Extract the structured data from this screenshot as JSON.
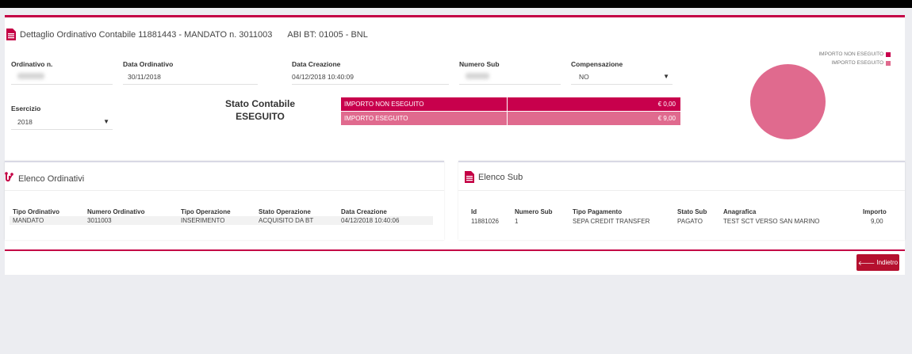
{
  "header": {
    "title": "Dettaglio Ordinativo Contabile 11881443 - MANDATO n. 3011003",
    "abi": "ABI BT: 01005 - BNL"
  },
  "fields": {
    "ordinativo_label": "Ordinativo n.",
    "data_ordinativo_label": "Data Ordinativo",
    "data_ordinativo_value": "30/11/2018",
    "data_creazione_label": "Data Creazione",
    "data_creazione_value": "04/12/2018 10:40:09",
    "numero_sub_label": "Numero Sub",
    "compensazione_label": "Compensazione",
    "compensazione_value": "NO",
    "esercizio_label": "Esercizio",
    "esercizio_value": "2018"
  },
  "stato": {
    "label": "Stato Contabile",
    "value": "ESEGUITO"
  },
  "importi": [
    {
      "label": "IMPORTO NON ESEGUITO",
      "value": "€ 0,00",
      "color": "#c8004c"
    },
    {
      "label": "IMPORTO ESEGUITO",
      "value": "€ 9,00",
      "color": "#e06a8e"
    }
  ],
  "chart_data": {
    "type": "pie",
    "series": [
      {
        "name": "IMPORTO NON ESEGUITO",
        "value": 0,
        "color": "#c8004c"
      },
      {
        "name": "IMPORTO ESEGUITO",
        "value": 9,
        "color": "#e06a8e"
      }
    ],
    "legend": "top-right"
  },
  "elenco_ordinativi": {
    "title": "Elenco Ordinativi",
    "headers": [
      "Tipo Ordinativo",
      "Numero Ordinativo",
      "Tipo Operazione",
      "Stato Operazione",
      "Data Creazione"
    ],
    "rows": [
      [
        "MANDATO",
        "3011003",
        "INSERIMENTO",
        "ACQUISITO DA BT",
        "04/12/2018 10:40:06"
      ]
    ]
  },
  "elenco_sub": {
    "title": "Elenco Sub",
    "headers": [
      "Id",
      "Numero Sub",
      "Tipo Pagamento",
      "Stato Sub",
      "Anagrafica",
      "Importo"
    ],
    "rows": [
      [
        "11881026",
        "1",
        "SEPA CREDIT TRANSFER",
        "PAGATO",
        "TEST SCT VERSO SAN MARINO",
        "9,00"
      ]
    ]
  },
  "buttons": {
    "indietro": "Indietro"
  },
  "colors": {
    "accent": "#c40045",
    "button": "#b5102f"
  }
}
